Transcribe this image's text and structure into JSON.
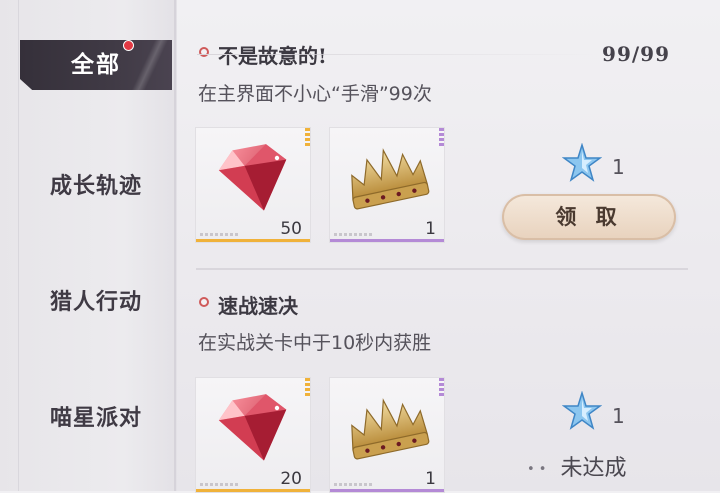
{
  "sidebar": {
    "tabs": [
      {
        "label": "全部",
        "active": true,
        "has_badge": true
      },
      {
        "label": "成长轨迹"
      },
      {
        "label": "猎人行动"
      },
      {
        "label": "喵星派对"
      }
    ]
  },
  "quests": [
    {
      "title": "不是故意的!",
      "description": "在主界面不小心“手滑”99次",
      "progress": "99/99",
      "rewards": [
        {
          "icon": "gem-icon",
          "count": "50",
          "rarity_color": "#f0b23a"
        },
        {
          "icon": "crown-icon",
          "count": "1",
          "rarity_color": "#b48ad6"
        }
      ],
      "star_points": "1",
      "action_label": "领 取"
    },
    {
      "title": "速战速决",
      "description": "在实战关卡中于10秒内获胜",
      "rewards": [
        {
          "icon": "gem-icon",
          "count": "20",
          "rarity_color": "#f0b23a"
        },
        {
          "icon": "crown-icon",
          "count": "1",
          "rarity_color": "#b48ad6"
        }
      ],
      "star_points": "1",
      "status_label": "未达成"
    }
  ],
  "colors": {
    "accent_red": "#e23a44",
    "tab_active": "#3a343f"
  }
}
